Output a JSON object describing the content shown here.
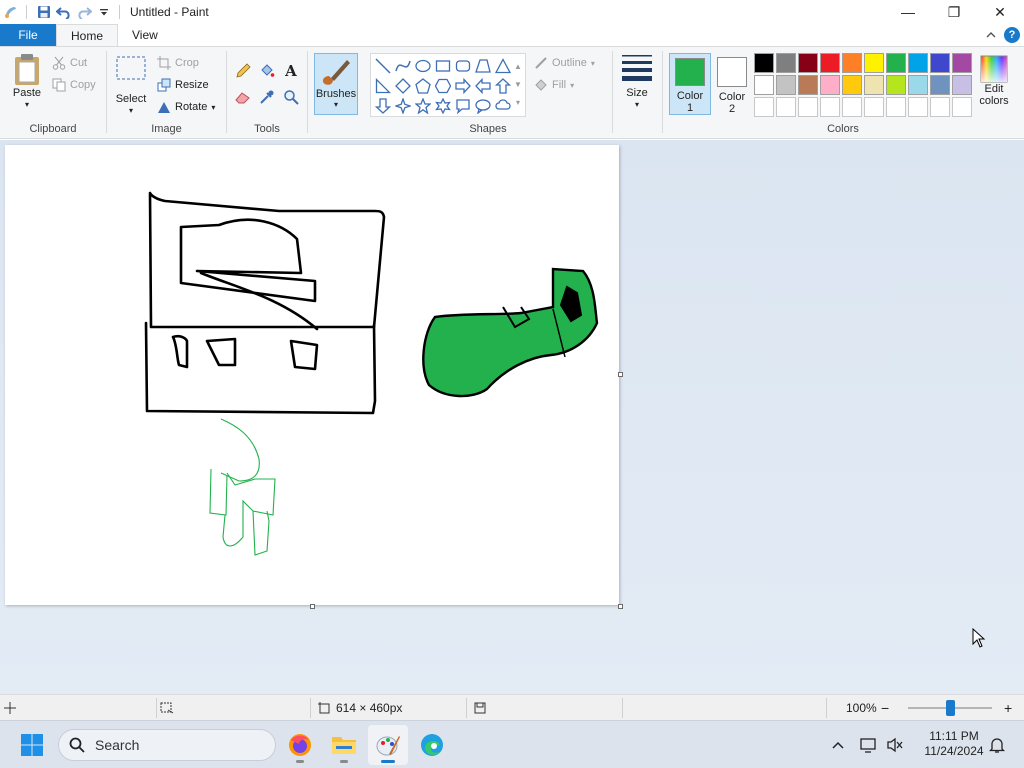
{
  "window": {
    "title": "Untitled - Paint",
    "minimize_glyph": "—",
    "maximize_glyph": "❐",
    "close_glyph": "✕"
  },
  "tabs": {
    "file": "File",
    "home": "Home",
    "view": "View",
    "help_glyph": "?"
  },
  "ribbon": {
    "clipboard": {
      "paste": "Paste",
      "cut": "Cut",
      "copy": "Copy",
      "label": "Clipboard"
    },
    "image": {
      "select": "Select",
      "crop": "Crop",
      "resize": "Resize",
      "rotate": "Rotate",
      "label": "Image"
    },
    "tools": {
      "label": "Tools",
      "text_glyph": "A"
    },
    "brushes": {
      "label": "Brushes"
    },
    "shapes": {
      "outline": "Outline",
      "fill": "Fill",
      "label": "Shapes"
    },
    "size": {
      "label": "Size"
    },
    "colors": {
      "color1_line1": "Color",
      "color1_line2": "1",
      "color2_line1": "Color",
      "color2_line2": "2",
      "edit_line1": "Edit",
      "edit_line2": "colors",
      "label": "Colors",
      "color1_value": "#22b14c",
      "color2_value": "#ffffff",
      "palette_row1": [
        "#000000",
        "#7f7f7f",
        "#880015",
        "#ed1c24",
        "#ff7f27",
        "#fff200",
        "#22b14c",
        "#00a2e8",
        "#3f48cc",
        "#a349a4"
      ],
      "palette_row2": [
        "#ffffff",
        "#c3c3c3",
        "#b97a57",
        "#ffaec9",
        "#ffc90e",
        "#efe4b0",
        "#b5e61d",
        "#99d9ea",
        "#7092be",
        "#c8bfe7"
      ],
      "palette_row3": [
        "#ffffff",
        "#ffffff",
        "#ffffff",
        "#ffffff",
        "#ffffff",
        "#ffffff",
        "#ffffff",
        "#ffffff",
        "#ffffff",
        "#ffffff"
      ]
    }
  },
  "statusbar": {
    "canvas_size": "614 × 460px",
    "zoom": "100%",
    "zoom_minus": "−",
    "zoom_plus": "+"
  },
  "taskbar": {
    "search_placeholder": "Search",
    "time": "11:11 PM",
    "date": "11/24/2024"
  }
}
